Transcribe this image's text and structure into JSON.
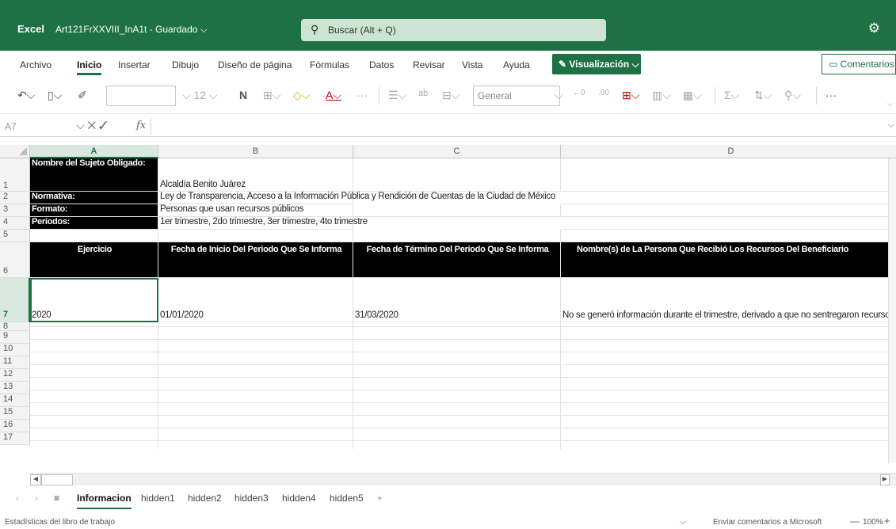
{
  "title_bar": {
    "app_name": "Excel",
    "doc_name": "Art121FrXXVIII_InA1t - Guardado",
    "doc_chevron": "⌵",
    "search_placeholder": "Buscar (Alt + Q)",
    "settings_icon": "gear-icon"
  },
  "ribbon_tabs": [
    "Archivo",
    "Inicio",
    "Insertar",
    "Dibujo",
    "Diseño de página",
    "Fórmulas",
    "Datos",
    "Revisar",
    "Vista",
    "Ayuda"
  ],
  "active_ribbon_tab": "Inicio",
  "visualization_button": "Visualización",
  "comments_button": "Comentarios",
  "toolbar": {
    "font_size": "12",
    "bold": "N",
    "number_format": "General",
    "more": "···"
  },
  "formula_bar": {
    "name_box": "A7",
    "fx": "fx",
    "content": ""
  },
  "columns": [
    "A",
    "B",
    "C",
    "D"
  ],
  "rows": [
    "1",
    "2",
    "3",
    "4",
    "5",
    "6",
    "7",
    "8",
    "9",
    "10",
    "11",
    "12",
    "13",
    "14",
    "15",
    "16",
    "17"
  ],
  "cells": {
    "A1": "Nombre del Sujeto Obligado:",
    "B1": "Alcaldía Benito Juárez",
    "A2": "Normativa:",
    "B2": "Ley de Transparencia, Acceso a la Información Pública y Rendición de Cuentas de la Ciudad de México",
    "A3": "Formato:",
    "B3": "Personas que usan recursos públicos",
    "A4": "Periodos:",
    "B4": "1er trimestre, 2do trimestre, 3er trimestre, 4to trimestre",
    "A6": "Ejercicio",
    "B6": "Fecha de Inicio Del Periodo Que Se Informa",
    "C6": "Fecha de Término Del Periodo Que Se Informa",
    "D6": "Nombre(s) de La Persona Que Recibió Los Recursos Del Beneficiario",
    "A7": "2020",
    "B7": "01/01/2020",
    "C7": "31/03/2020",
    "D7": "No se generó información durante el trimestre, derivado a que no sentregaron recurso"
  },
  "selected_cell": "A7",
  "sheet_tabs": [
    "Informacion",
    "hidden1",
    "hidden2",
    "hidden3",
    "hidden4",
    "hidden5"
  ],
  "active_sheet": "Informacion",
  "add_sheet": "+",
  "status_bar": {
    "left": "Estadísticas del libro de trabajo",
    "feedback": "Enviar comentarios a Microsoft",
    "zoom": "100%",
    "zoom_minus": "—",
    "zoom_plus": "+"
  },
  "colors": {
    "brand_green": "#1e7145",
    "header_black": "#000000"
  }
}
